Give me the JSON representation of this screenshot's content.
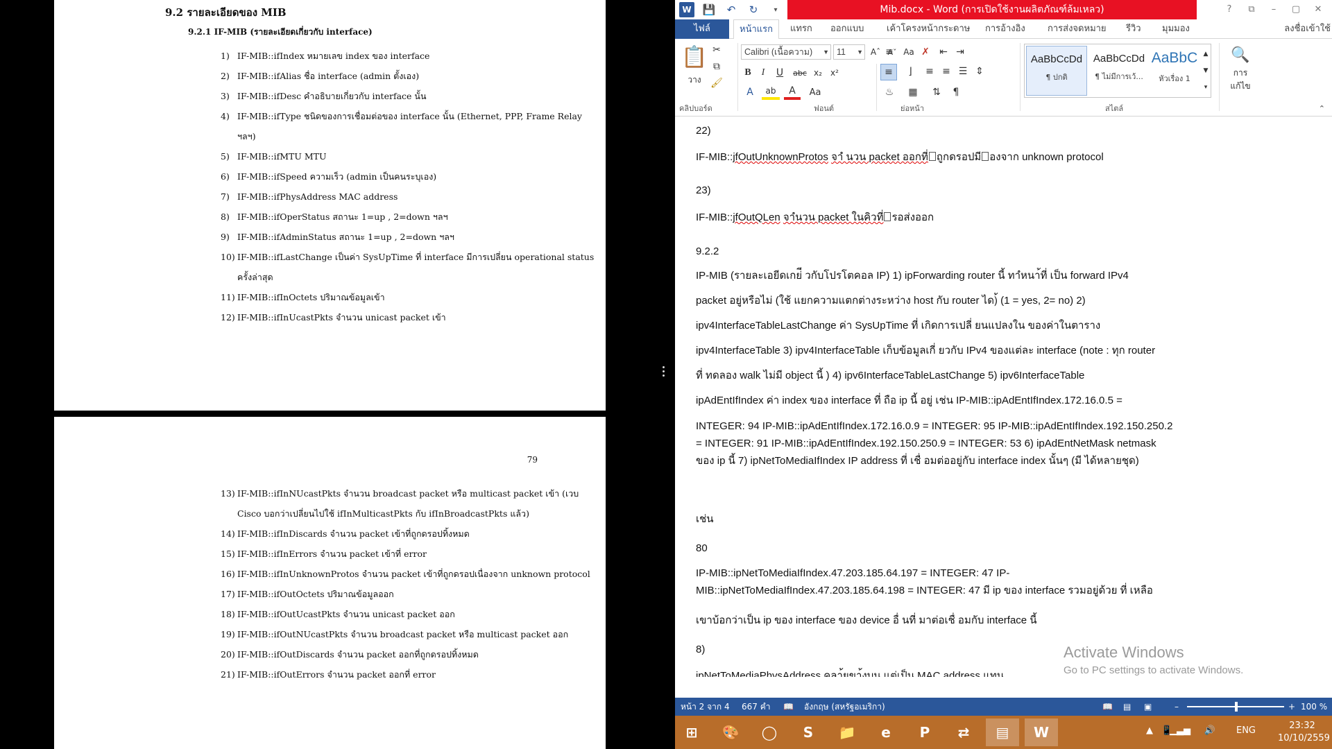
{
  "pdf": {
    "page1": {
      "section": "9.2  รายละเอียดของ MIB",
      "subsection": "9.2.1     IF-MIB (รายละเอียดเกี่ยวกับ interface)",
      "items": [
        {
          "n": "1)",
          "t": "IF-MIB::ifIndex หมายเลข index ของ interface"
        },
        {
          "n": "2)",
          "t": "IF-MIB::ifAlias ชื่อ interface (admin ตั้งเอง)"
        },
        {
          "n": "3)",
          "t": "IF-MIB::ifDesc คำอธิบายเกี่ยวกับ interface นั้น"
        },
        {
          "n": "4)",
          "t": "IF-MIB::ifType   ชนิดของการเชื่อมต่อของ interface   นั้น (Ethernet,   PPP, Frame Relay ฯลฯ)"
        },
        {
          "n": "5)",
          "t": "IF-MIB::ifMTU MTU"
        },
        {
          "n": "6)",
          "t": "IF-MIB::ifSpeed ความเร็ว (admin เป็นคนระบุเอง)"
        },
        {
          "n": "7)",
          "t": "IF-MIB::ifPhysAddress MAC address"
        },
        {
          "n": "8)",
          "t": "IF-MIB::ifOperStatus สถานะ 1=up , 2=down ฯลฯ"
        },
        {
          "n": "9)",
          "t": "IF-MIB::ifAdminStatus สถานะ 1=up , 2=down ฯลฯ"
        },
        {
          "n": "10)",
          "t": "IF-MIB::ifLastChange    เป็นค่า    SysUpTime    ที่ interface    มีการเปลี่ยน operational status ครั้งล่าสุด"
        },
        {
          "n": "11)",
          "t": "IF-MIB::ifInOctets ปริมาณข้อมูลเข้า"
        },
        {
          "n": "12)",
          "t": "IF-MIB::ifInUcastPkts จำนวน unicast packet เข้า"
        }
      ]
    },
    "page2": {
      "page_number": "79",
      "items": [
        {
          "n": "13)",
          "t": "IF-MIB::ifInNUcastPkts จำนวน broadcast packet หรือ multicast packet เข้า (เวบ Cisco   บอกว่าเปลี่ยนไปใช้ ifInMulticastPkts   กับ ifInBroadcastPkts แล้ว)"
        },
        {
          "n": "14)",
          "t": "IF-MIB::ifInDiscards จำนวน packet เข้าที่ถูกดรอปทิ้งหมด"
        },
        {
          "n": "15)",
          "t": "IF-MIB::ifInErrors จำนวน packet เข้าที่ error"
        },
        {
          "n": "16)",
          "t": "IF-MIB::ifInUnknownProtos    จำนวน packet    เข้าที่ถูกดรอปเนื่องจาก unknown protocol"
        },
        {
          "n": "17)",
          "t": "IF-MIB::ifOutOctets ปริมาณข้อมูลออก"
        },
        {
          "n": "18)",
          "t": "IF-MIB::ifOutUcastPkts จำนวน unicast packet ออก"
        },
        {
          "n": "19)",
          "t": "IF-MIB::ifOutNUcastPkts  จำนวน broadcast  packet  หรือ multicast  packet ออก"
        },
        {
          "n": "20)",
          "t": "IF-MIB::ifOutDiscards จำนวน packet ออกที่ถูกดรอปทิ้งหมด"
        },
        {
          "n": "21)",
          "t": "IF-MIB::ifOutErrors จำนวน packet ออกที่ error"
        }
      ]
    }
  },
  "word": {
    "title": "Mib.docx - Word (การเปิดใช้งานผลิตภัณฑ์ล้มเหลว)",
    "window_controls": [
      "?",
      "⧉",
      "–",
      "▢",
      "✕"
    ],
    "tabs": {
      "file": "ไฟล์",
      "home": "หน้าแรก",
      "insert": "แทรก",
      "design": "ออกแบบ",
      "layout": "เค้าโครงหน้ากระดาษ",
      "references": "การอ้างอิง",
      "mailings": "การส่งจดหมาย",
      "review": "รีวิว",
      "view": "มุมมอง",
      "signin": "ลงชื่อเข้าใช้"
    },
    "ribbon": {
      "paste": "วาง",
      "clipboard": "คลิปบอร์ด",
      "font_name": "Calibri (เนื้อความ)",
      "font_size": "11",
      "font_group": "ฟอนต์",
      "paragraph_group": "ย่อหน้า",
      "styles_group": "สไตล์",
      "styles": [
        {
          "sample": "AaBbCcDd",
          "name": "¶ ปกติ"
        },
        {
          "sample": "AaBbCcDd",
          "name": "¶ ไม่มีการเว้..."
        },
        {
          "sample": "AaBbC",
          "name": "หัวเรื่อง 1"
        }
      ],
      "editing": "การ\nแก้ไข"
    },
    "doc": {
      "p1": "22)",
      "p2_a": "IF-MIB::",
      "p2_b": "jfOutUnknownProtos",
      "p2_c": "จาํ นวน packet ออกที่",
      "p2_d": "ถูกดรอปมี",
      "p2_e": "องจาก unknown protocol",
      "p3": "23)",
      "p4_a": "IF-MIB::",
      "p4_b": "jfOutQLen",
      "p4_c": "จาํนวน packet ในคิวที่",
      "p4_d": "รอส่งออก",
      "p5": "9.2.2",
      "p6_l1": "IP-MIB (รายละเอยีดเกย่ี วกับโปรโตคอล IP) 1) ipForwarding    router นี้ ทาํหนา้ที่ เป็น forward IPv4",
      "p6_l2": "packet อยู่หรือไม่ (ใช้ แยกความแตกต่างระหว่าง host กับ router ได)้ (1 = yes, 2= no)  2)",
      "p6_l3": "ipv4InterfaceTableLastChange  ค่า SysUpTime ที่ เกิดการเปลี่ ยนแปลงใน ของค่าในตาราง",
      "p6_l4": "ipv4InterfaceTable  3) ipv4InterfaceTable   เก็บข้อมูลเกี่ ยวกับ IPv4 ของแต่ละ interface (note : ทุก router",
      "p6_l5": "ที่ ทดลอง walk ไม่มี object นี้ )  4) ipv6InterfaceTableLastChange  5) ipv6InterfaceTable",
      "p6_l6": "ipAdEntIfIndex   ค่า index ของ interface ที่ ถือ ip นี้ อยู่ เช่น IP-MIB::ipAdEntIfIndex.172.16.0.5 =",
      "p6_l7": "INTEGER: 94 IP-MIB::ipAdEntIfIndex.172.16.0.9 = INTEGER: 95 IP-MIB::ipAdEntIfIndex.192.150.250.2",
      "p6_l8": "= INTEGER: 91 IP-MIB::ipAdEntIfIndex.192.150.250.9 = INTEGER: 53  6) ipAdEntNetMask   netmask",
      "p6_l9": "ของ ip นี้   7) ipNetToMediaIfIndex  IP address ที่ เชื่ อมต่ออยู่กับ interface index นั้นๆ (มี ได้หลายชุด)",
      "p6_l10": "เช่น",
      "p7": "80",
      "p8_l1": "IP-MIB::ipNetToMediaIfIndex.47.203.185.64.197 = INTEGER: 47 IP-",
      "p8_l2": "MIB::ipNetToMediaIfIndex.47.203.185.64.198 = INTEGER: 47 มี ip ของ interface รวมอยู่ด้วย ที่ เหลือ",
      "p8_l3": "เขาบ้อกว่าเป็น ip ของ interface ของ device อื่ นที่ มาต่อเชื่ อมกับ interface นี้",
      "p9": "8)",
      "p10": "ipNetToMediaPhysAddress  คลา้ยขา้งบน แต่เป็น MAC address แทน"
    },
    "activate_title": "Activate Windows",
    "activate_sub": "Go to PC settings to activate Windows.",
    "status": {
      "page": "หน้า 2 จาก 4",
      "words": "667 คำ",
      "language": "อังกฤษ (สหรัฐอเมริกา)",
      "zoom": "100 %"
    }
  },
  "taskbar": {
    "lang": "ENG",
    "time": "23:32",
    "date": "10/10/2559"
  }
}
